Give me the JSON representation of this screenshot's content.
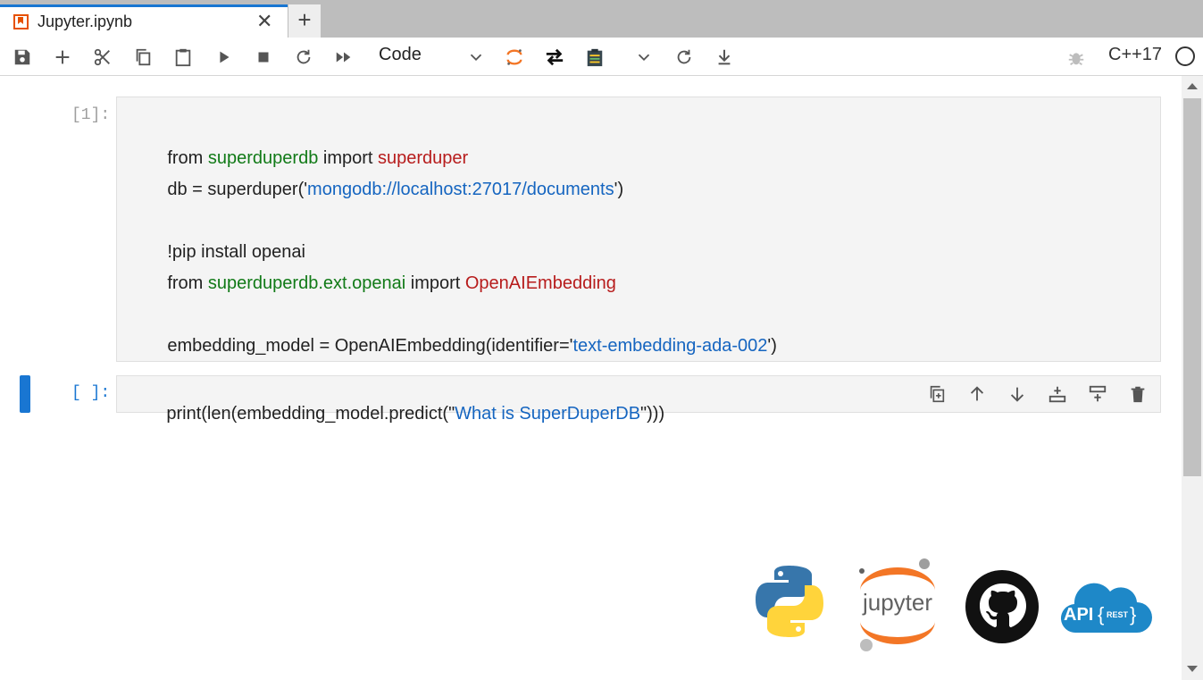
{
  "tab": {
    "title": "Jupyter.ipynb",
    "close_glyph": "✕",
    "new_tab_glyph": "+"
  },
  "toolbar": {
    "cell_type": "Code",
    "kernel_name": "C++17",
    "icons": [
      "save-icon",
      "add-icon",
      "cut-icon",
      "copy-icon",
      "paste-icon",
      "run-icon",
      "stop-icon",
      "restart-icon",
      "run-all-icon",
      "jupyter-icon",
      "switch-icon",
      "clipboard-icon",
      "chevron-down-icon",
      "refresh-icon",
      "download-icon",
      "bug-icon",
      "kernel-status-icon"
    ]
  },
  "cells": [
    {
      "prompt": "[1]:",
      "lines": [
        {
          "parts": [
            {
              "t": "from ",
              "c": "plain"
            },
            {
              "t": "superduperdb",
              "c": "mod"
            },
            {
              "t": " import ",
              "c": "plain"
            },
            {
              "t": "superduper",
              "c": "cls"
            }
          ]
        },
        {
          "parts": [
            {
              "t": "db = superduper('",
              "c": "plain"
            },
            {
              "t": "mongodb://localhost:27017/documents",
              "c": "str"
            },
            {
              "t": "')",
              "c": "plain"
            }
          ]
        },
        {
          "parts": [
            {
              "t": "!pip install openai",
              "c": "plain"
            }
          ]
        },
        {
          "parts": [
            {
              "t": "from ",
              "c": "plain"
            },
            {
              "t": "superduperdb.ext.openai",
              "c": "mod"
            },
            {
              "t": " import ",
              "c": "plain"
            },
            {
              "t": "OpenAIEmbedding",
              "c": "cls"
            }
          ]
        },
        {
          "parts": [
            {
              "t": "embedding_model = OpenAIEmbedding(identifier='",
              "c": "plain"
            },
            {
              "t": "text-embedding-ada-002",
              "c": "str"
            },
            {
              "t": "')",
              "c": "plain"
            }
          ]
        }
      ]
    },
    {
      "prompt": "[ ]:",
      "lines": [
        {
          "parts": [
            {
              "t": "print(len(embedding_model.predict(\"",
              "c": "plain"
            },
            {
              "t": "What is SuperDuperDB",
              "c": "str"
            },
            {
              "t": "\")))",
              "c": "plain"
            }
          ]
        }
      ]
    }
  ],
  "cell_toolbar_icons": [
    "duplicate-icon",
    "move-up-icon",
    "move-down-icon",
    "insert-below-icon",
    "insert-above-icon",
    "delete-icon"
  ],
  "logos": {
    "jupyter_text": "jupyter",
    "api_text": "API",
    "rest_text": "REST"
  },
  "colors": {
    "accent": "#1976d2",
    "module": "#117a17",
    "class": "#b71c1c",
    "string": "#1565c0"
  }
}
